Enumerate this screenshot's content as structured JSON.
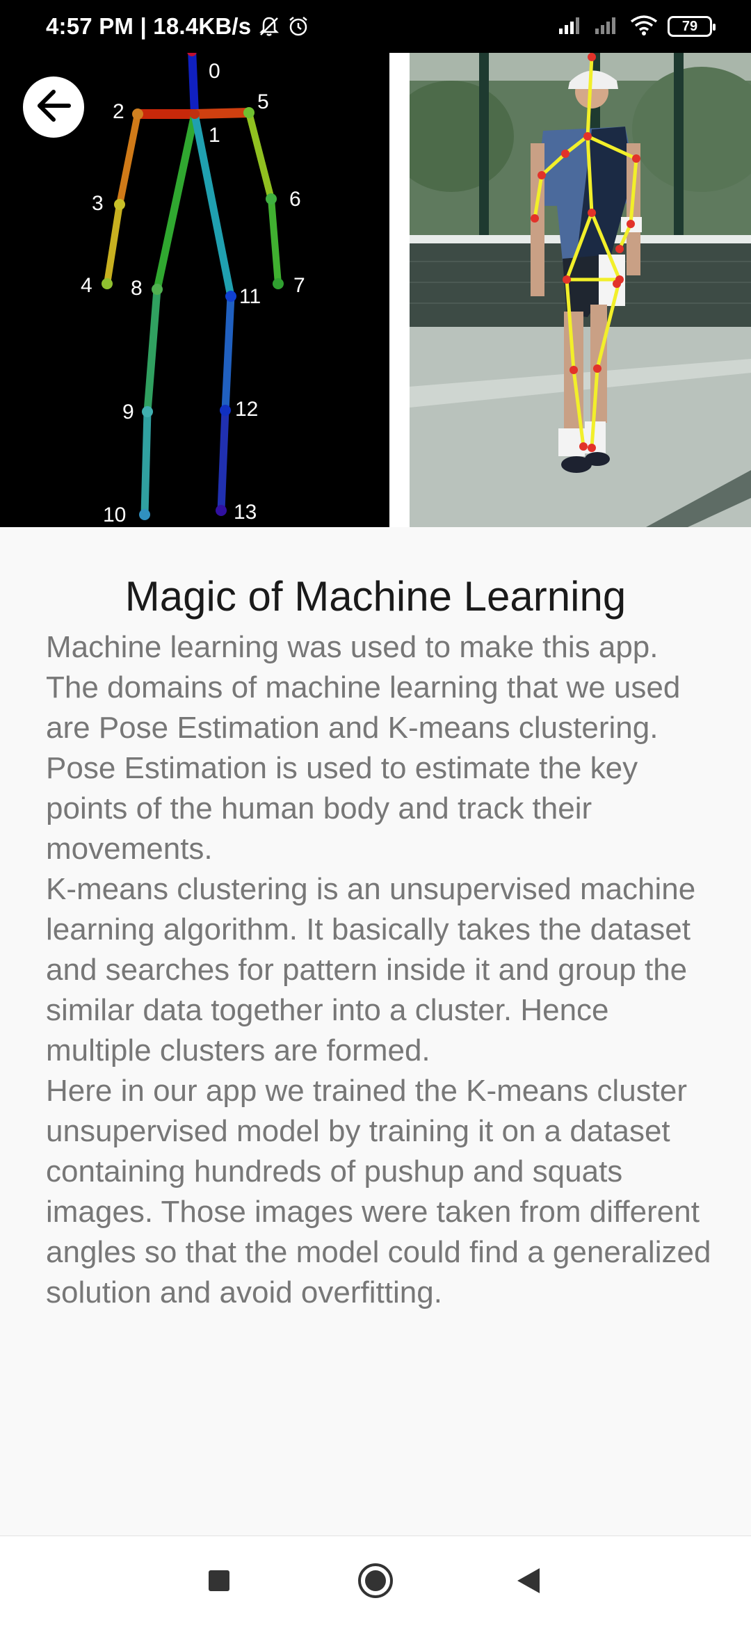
{
  "status_bar": {
    "time_speed": "4:57 PM | 18.4KB/s",
    "battery": "79",
    "icons": [
      "mute-bell-icon",
      "alarm-icon",
      "signal-icon",
      "signal-icon",
      "wifi-icon",
      "battery-icon"
    ]
  },
  "skeleton": {
    "keypoint_labels": [
      "0",
      "1",
      "2",
      "3",
      "4",
      "5",
      "6",
      "7",
      "8",
      "9",
      "10",
      "11",
      "12",
      "13"
    ]
  },
  "header": {
    "back_icon": "arrow-left-icon",
    "photo_icon": "pose-estimation-photo"
  },
  "content": {
    "title": "Magic of Machine Learning",
    "paragraphs": [
      "Machine learning was used to make this app. The domains of machine learning that we used are Pose Estimation and K-means clustering.",
      "Pose Estimation is used to estimate the key points of the human body and track their movements.",
      "K-means clustering is an unsupervised machine learning algorithm. It basically takes the dataset and searches for pattern inside it and group the similar data together into a cluster. Hence multiple clusters are formed.",
      "Here in our app we trained the K-means cluster unsupervised model by training it on a dataset containing hundreds of pushup and squats images. Those images were taken from different angles so that the model could find a generalized solution and avoid overfitting."
    ]
  },
  "nav": {
    "icons": [
      "recents-square-icon",
      "home-circle-icon",
      "back-triangle-icon"
    ]
  }
}
